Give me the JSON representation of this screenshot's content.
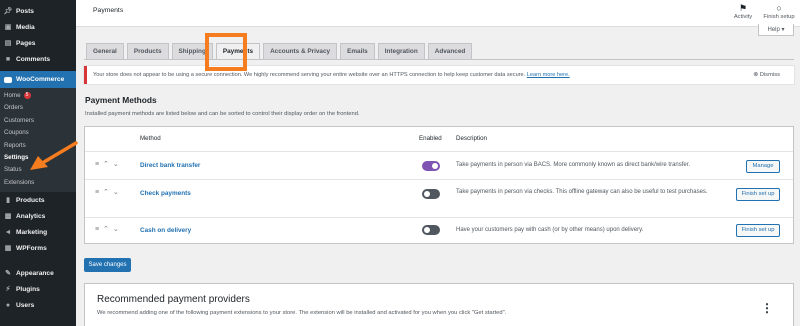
{
  "sidebar": {
    "items_top": [
      {
        "label": "Posts",
        "icon": "pushpin-icon"
      },
      {
        "label": "Media",
        "icon": "media-icon"
      },
      {
        "label": "Pages",
        "icon": "pages-icon"
      },
      {
        "label": "Comments",
        "icon": "comments-icon"
      }
    ],
    "woocommerce_label": "WooCommerce",
    "submenu": [
      {
        "label": "Home",
        "badge": "5"
      },
      {
        "label": "Orders"
      },
      {
        "label": "Customers"
      },
      {
        "label": "Coupons"
      },
      {
        "label": "Reports"
      },
      {
        "label": "Settings"
      },
      {
        "label": "Status"
      },
      {
        "label": "Extensions"
      }
    ],
    "items_bottom": [
      {
        "label": "Products"
      },
      {
        "label": "Analytics"
      },
      {
        "label": "Marketing"
      },
      {
        "label": "WPForms"
      }
    ],
    "items_bottom2": [
      {
        "label": "Appearance"
      },
      {
        "label": "Plugins"
      },
      {
        "label": "Users"
      }
    ]
  },
  "header": {
    "title": "Payments",
    "activity_label": "Activity",
    "finish_setup_label": "Finish setup",
    "help_label": "Help"
  },
  "tabs": [
    "General",
    "Products",
    "Shipping",
    "Payments",
    "Accounts & Privacy",
    "Emails",
    "Integration",
    "Advanced"
  ],
  "notice": {
    "text": "Your store does not appear to be using a secure connection. We highly recommend serving your entire website over an HTTPS connection to help keep customer data secure.",
    "link": "Learn more here.",
    "dismiss": "Dismiss"
  },
  "payment_methods": {
    "title": "Payment Methods",
    "description": "Installed payment methods are listed below and can be sorted to control their display order on the frontend.",
    "columns": {
      "method": "Method",
      "enabled": "Enabled",
      "description": "Description"
    },
    "rows": [
      {
        "name": "Direct bank transfer",
        "enabled": true,
        "description": "Take payments in person via BACS. More commonly known as direct bank/wire transfer.",
        "action": "Manage"
      },
      {
        "name": "Check payments",
        "enabled": false,
        "description": "Take payments in person via checks. This offline gateway can also be useful to test purchases.",
        "action": "Finish set up"
      },
      {
        "name": "Cash on delivery",
        "enabled": false,
        "description": "Have your customers pay with cash (or by other means) upon delivery.",
        "action": "Finish set up"
      }
    ],
    "save_label": "Save changes"
  },
  "recommended": {
    "title": "Recommended payment providers",
    "description": "We recommend adding one of the following payment extensions to your store. The extension will be installed and activated for you when you click \"Get started\"."
  },
  "colors": {
    "accent": "#2271b1",
    "highlight": "#f57c1f",
    "toggle_on": "#7f54b3",
    "sidebar": "#1d2327"
  }
}
